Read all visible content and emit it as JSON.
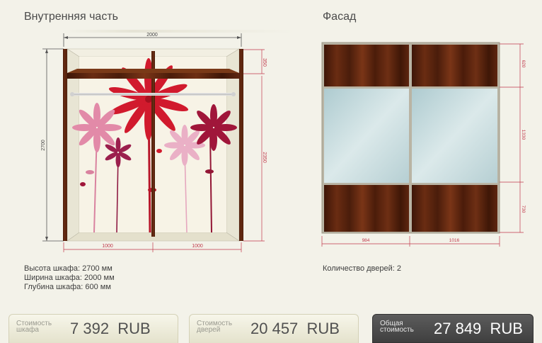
{
  "interior": {
    "title": "Внутренняя часть",
    "dim_width": "2000",
    "dim_height": "2700",
    "dim_shelf": "350",
    "dim_hanging": "2350",
    "dim_left": "1000",
    "dim_right": "1000"
  },
  "facade": {
    "title": "Фасад",
    "dim_top": "620",
    "dim_middle": "1330",
    "dim_bottom": "730",
    "dim_left": "984",
    "dim_right": "1016",
    "doors_count": "Количество дверей: 2"
  },
  "specs": {
    "height": "Высота шкафа: 2700 мм",
    "width": "Ширина шкафа: 2000 мм",
    "depth": "Глубина шкафа: 600 мм"
  },
  "footer": {
    "cabinet_label": "Стоимость шкафа",
    "cabinet_value": "7 392  RUB",
    "doors_label": "Стоимость дверей",
    "doors_value": "20 457  RUB",
    "total_label": "Общая стоимость",
    "total_value": "27 849  RUB"
  },
  "colors": {
    "wood": "#4a1f0d",
    "frame": "#6b3a1a",
    "dimension_line": "#c0394b",
    "mirror": "#c8dcdf",
    "background": "#f3f2e9"
  }
}
